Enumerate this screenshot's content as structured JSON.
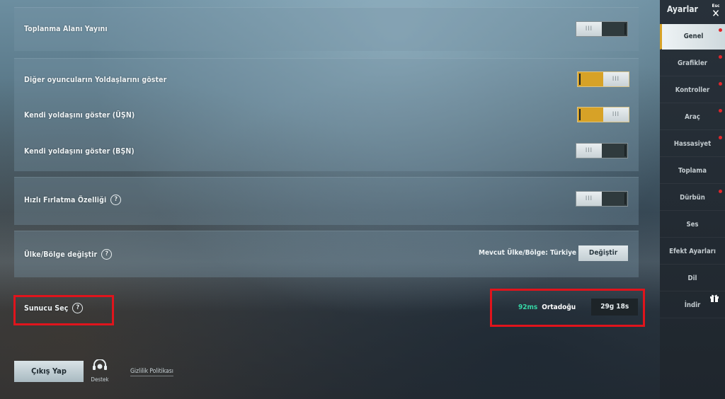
{
  "settings": {
    "gathering_area": "Toplanma Alanı Yayını",
    "show_others_teammates": "Diğer oyuncuların Yoldaşlarını göster",
    "show_teammate_tpp": "Kendi yoldaşını göster (ÜŞN)",
    "show_teammate_fpp": "Kendi yoldaşını göster (BŞN)",
    "quick_throw": "Hızlı Fırlatma Özelliği",
    "country_change": "Ülke/Bölge değiştir",
    "current_country": "Mevcut Ülke/Bölge: Türkiye",
    "change_button": "Değiştir",
    "server_select": "Sunucu Seç",
    "ping": "92ms",
    "server_name": "Ortadoğu",
    "server_timer": "29g 18s",
    "toggle_knob": "III",
    "help_glyph": "?"
  },
  "toggles": {
    "gathering_area_on": false,
    "show_others_teammates_on": true,
    "show_teammate_tpp_on": true,
    "show_teammate_fpp_on": false,
    "quick_throw_on": false
  },
  "footer": {
    "exit_label": "Çıkış Yap",
    "support_label": "Destek",
    "privacy_label": "Gizlilik Politikası"
  },
  "sidebar": {
    "title": "Ayarlar",
    "esc_label": "Esc",
    "close_glyph": "✕",
    "items": [
      {
        "label": "Genel",
        "active": true,
        "dot": true
      },
      {
        "label": "Grafikler",
        "active": false,
        "dot": true
      },
      {
        "label": "Kontroller",
        "active": false,
        "dot": true
      },
      {
        "label": "Araç",
        "active": false,
        "dot": true
      },
      {
        "label": "Hassasiyet",
        "active": false,
        "dot": true
      },
      {
        "label": "Toplama",
        "active": false,
        "dot": false
      },
      {
        "label": "Dürbün",
        "active": false,
        "dot": true
      },
      {
        "label": "Ses",
        "active": false,
        "dot": false
      },
      {
        "label": "Efekt Ayarları",
        "active": false,
        "dot": false
      },
      {
        "label": "Dil",
        "active": false,
        "dot": false
      },
      {
        "label": "İndir",
        "active": false,
        "dot": false
      }
    ]
  },
  "colors": {
    "accent": "#d7a227",
    "ping_green": "#35d6a5",
    "highlight_red": "#e0141c",
    "notification_dot": "#e0262b"
  }
}
